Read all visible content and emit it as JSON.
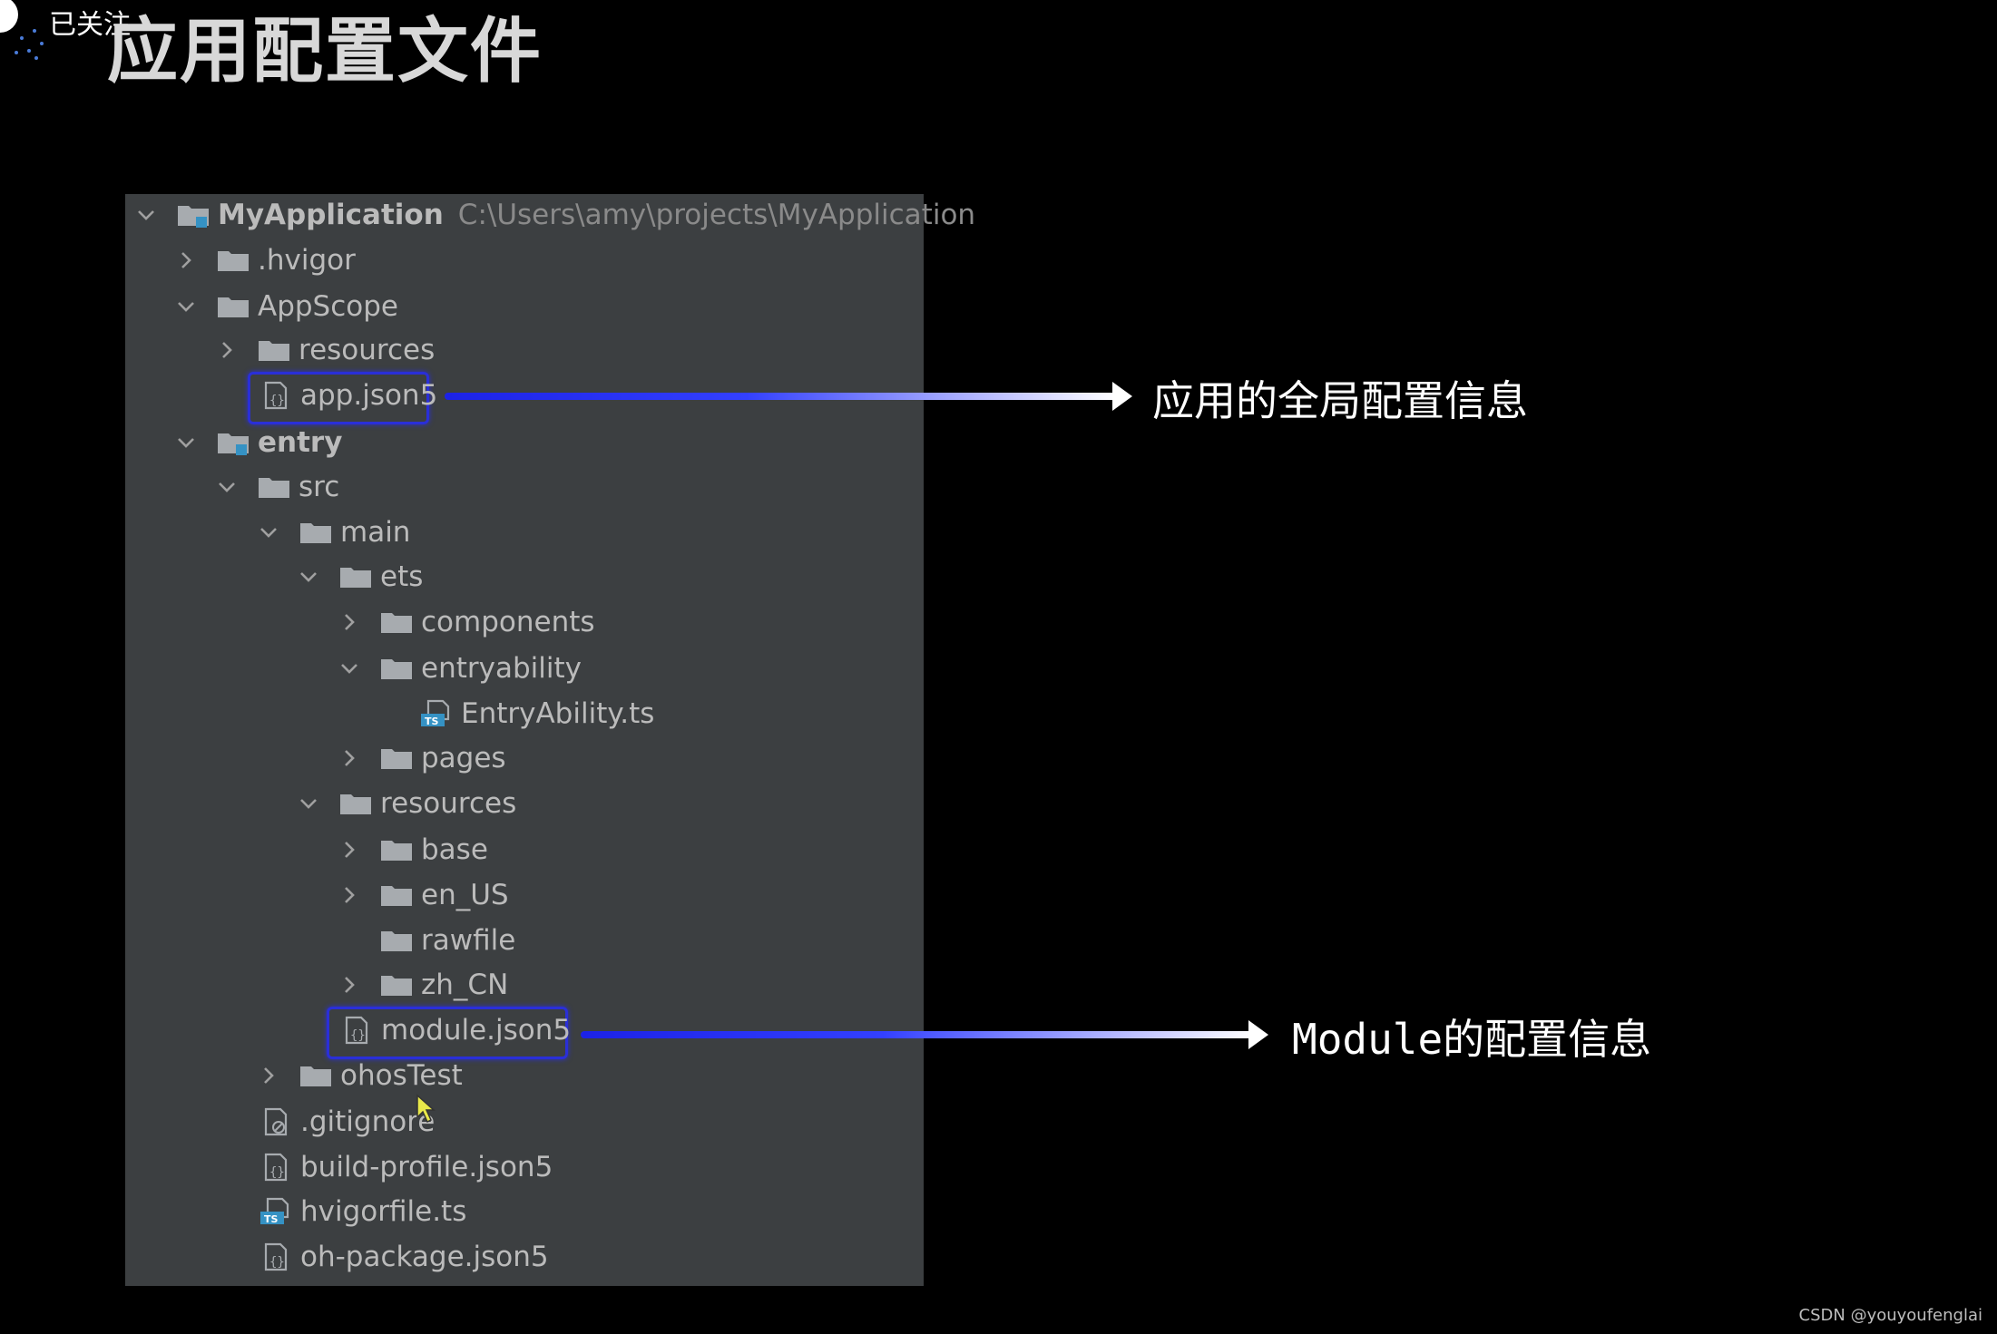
{
  "header": {
    "follow_label": "已关注",
    "title": "应用配置文件"
  },
  "tree": {
    "root": {
      "label": "MyApplication",
      "path": "C:\\Users\\amy\\projects\\MyApplication"
    },
    "items": [
      {
        "label": ".hvigor"
      },
      {
        "label": "AppScope"
      },
      {
        "label": "resources"
      },
      {
        "label": "app.json5"
      },
      {
        "label": "entry"
      },
      {
        "label": "src"
      },
      {
        "label": "main"
      },
      {
        "label": "ets"
      },
      {
        "label": "components"
      },
      {
        "label": "entryability"
      },
      {
        "label": "EntryAbility.ts"
      },
      {
        "label": "pages"
      },
      {
        "label": "resources"
      },
      {
        "label": "base"
      },
      {
        "label": "en_US"
      },
      {
        "label": "rawfile"
      },
      {
        "label": "zh_CN"
      },
      {
        "label": "module.json5"
      },
      {
        "label": "ohosTest"
      },
      {
        "label": ".gitignore"
      },
      {
        "label": "build-profile.json5"
      },
      {
        "label": "hvigorfile.ts"
      },
      {
        "label": "oh-package.json5"
      }
    ]
  },
  "annotations": {
    "app_config": "应用的全局配置信息",
    "module_config": "Module的配置信息"
  },
  "watermark": "CSDN @youyoufenglai",
  "colors": {
    "highlight": "#2a2fd8",
    "panel": "#3c3f41",
    "text": "#bbbbbb",
    "path": "#8a8a8a"
  }
}
